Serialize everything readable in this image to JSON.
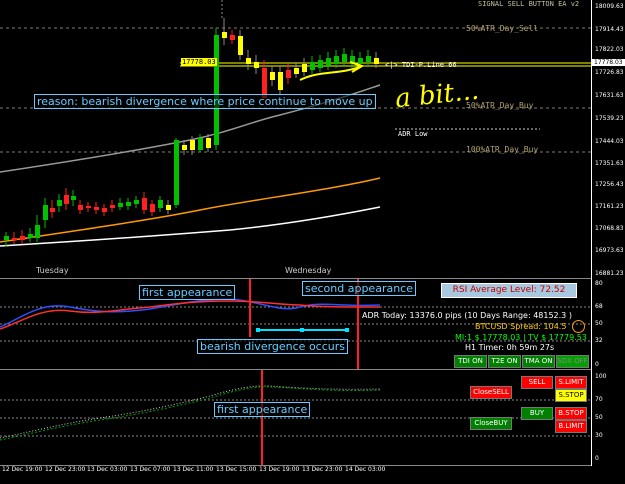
{
  "levels": {
    "atr50_sell": "50%ATR_Day_Sell",
    "atr50_buy": "50%ATR_Day_Buy",
    "atr100_buy": "100%ATR_Day_Buy",
    "adr_low": "ADR Low",
    "tdi_line": "<|> TDI-P.Line 66",
    "price_box": "17778.03",
    "top_header": "SIGNAL SELL BUTTON EA v2"
  },
  "price_axis": [
    "18009.63",
    "17914.43",
    "17822.03",
    "17778.03",
    "17726.83",
    "17631.63",
    "17539.23",
    "17444.03",
    "17351.63",
    "17256.43",
    "17161.23",
    "17068.83",
    "16973.63",
    "16881.23"
  ],
  "rsi_axis": [
    "80",
    "68",
    "50",
    "32",
    "0"
  ],
  "tdi_axis": [
    "100",
    "70",
    "50",
    "30",
    "0"
  ],
  "day_labels": {
    "tuesday": "Tuesday",
    "wednesday": "Wednesday"
  },
  "annotations": {
    "reason": "reason: bearish divergence where price continue to move up",
    "handwritten": "a bit...",
    "first_rsi": "first appearance",
    "second_rsi": "second appearance",
    "bearish": "bearish divergence occurs",
    "first_tdi": "first appearance"
  },
  "info": {
    "rsi_avg": "RSI Average Level:  72.52",
    "adr": "ADR Today: 13376.0 pips (10 Days Range: 48152.3 )",
    "spread": "BTCUSD Spread: 104.5",
    "mi": "MI:1 $ 17778.03  |  TV $ 17779.53",
    "timer": "H1 Timer: 0h 59m 27s"
  },
  "tdi_buttons": [
    "TDI ON",
    "T2E ON",
    "TMA ON",
    "SDX OFF"
  ],
  "trade_buttons": {
    "close_sell": "CloseSELL",
    "close_buy": "CloseBUY",
    "sell": "SELL",
    "s_limit": "S.LIMIT",
    "s_stop": "S.STOP",
    "buy": "BUY",
    "b_stop": "B.STOP",
    "b_limit": "B.LIMIT"
  },
  "time_axis": [
    "12 Dec 19:00",
    "12 Dec 23:00",
    "13 Dec 03:00",
    "13 Dec 07:00",
    "13 Dec 11:00",
    "13 Dec 15:00",
    "13 Dec 19:00",
    "13 Dec 23:00",
    "14 Dec 03:00"
  ],
  "colors": {
    "bull": "#00c000",
    "bear": "#ff2020",
    "doji": "#ffff00",
    "annotation": "#66ccff",
    "divider": "#ff2020"
  }
}
